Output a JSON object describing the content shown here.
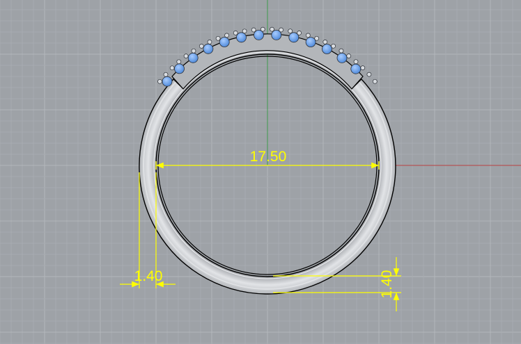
{
  "viewport": {
    "background_color": "#9ea2a7",
    "grid_minor_color": "#a7abb0",
    "grid_major_color": "#b3b7bb",
    "x_axis_color": "#b84040",
    "y_axis_color": "#3f9a4d"
  },
  "model": {
    "metal_color": "#cfd2d6",
    "gem_color": "#6fa8f0",
    "outline_color": "#000000"
  },
  "dimensions": {
    "color": "#ffff00",
    "inner_diameter": "17.50",
    "band_width": "1.40",
    "band_thickness": "1.40"
  }
}
